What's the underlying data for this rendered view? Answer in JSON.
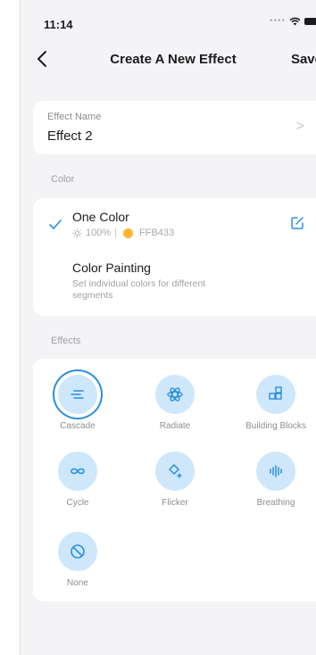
{
  "status": {
    "time": "11:14"
  },
  "nav": {
    "title": "Create A New Effect",
    "save_label": "Save"
  },
  "effect_name": {
    "label": "Effect Name",
    "value": "Effect 2"
  },
  "sections": {
    "color": "Color",
    "effects": "Effects"
  },
  "color": {
    "one_color": {
      "title": "One Color",
      "brightness": "100%",
      "hex": "FFB433",
      "swatch": "#FFB433",
      "selected": true
    },
    "painting": {
      "title": "Color Painting",
      "description": "Set individual colors for different segments"
    }
  },
  "effects": [
    {
      "label": "Cascade",
      "icon": "cascade-icon",
      "selected": true
    },
    {
      "label": "Radiate",
      "icon": "radiate-icon",
      "selected": false
    },
    {
      "label": "Building Blocks",
      "icon": "building-blocks-icon",
      "selected": false
    },
    {
      "label": "Cycle",
      "icon": "cycle-icon",
      "selected": false
    },
    {
      "label": "Flicker",
      "icon": "flicker-icon",
      "selected": false
    },
    {
      "label": "Breathing",
      "icon": "breathing-icon",
      "selected": false
    },
    {
      "label": "None",
      "icon": "none-icon",
      "selected": false
    }
  ],
  "colors": {
    "accent": "#2a8fe0",
    "icon_bg": "#cfe7fb"
  }
}
